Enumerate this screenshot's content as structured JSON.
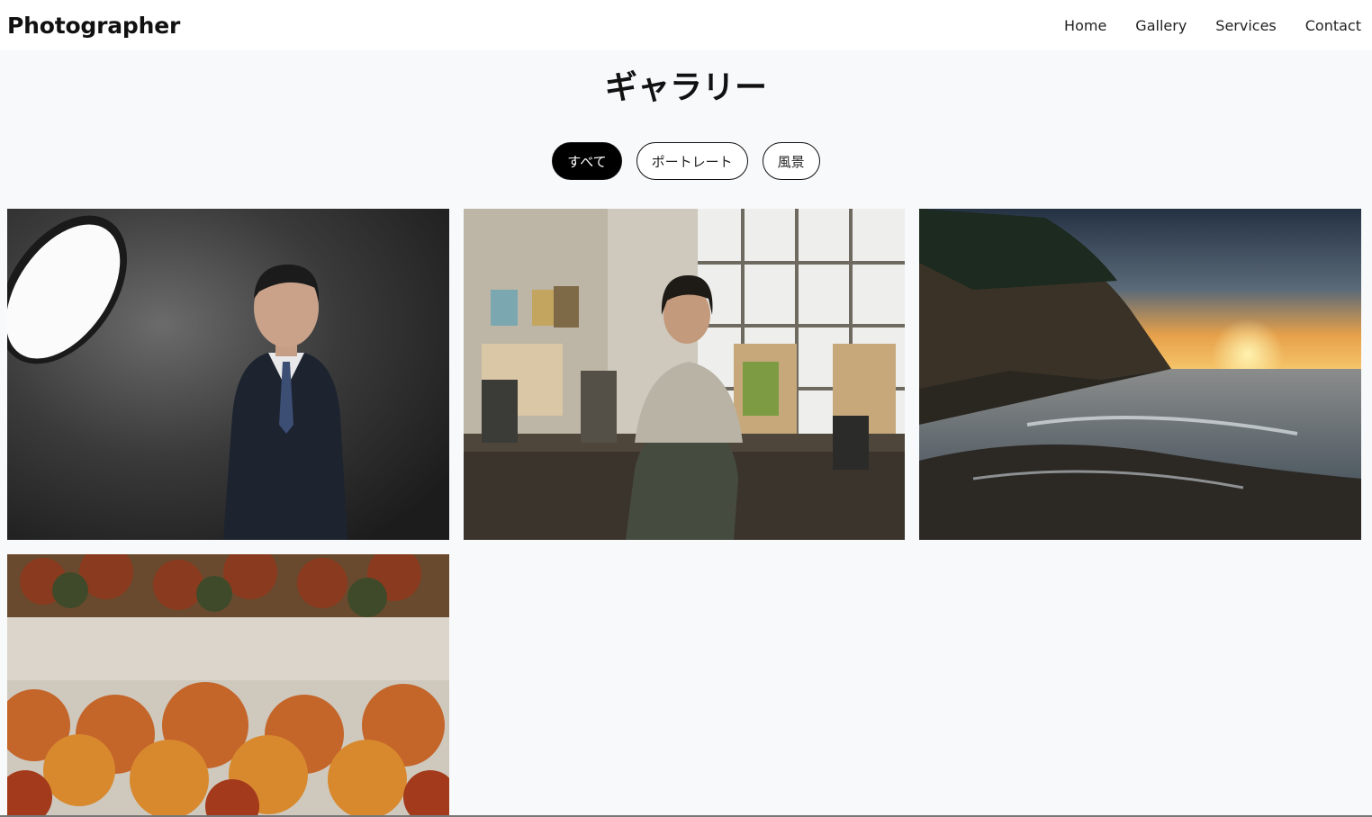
{
  "brand": "Photographer",
  "nav": [
    "Home",
    "Gallery",
    "Services",
    "Contact"
  ],
  "page_title": "ギャラリー",
  "filters": [
    {
      "label": "すべて",
      "active": true
    },
    {
      "label": "ポートレート",
      "active": false
    },
    {
      "label": "風景",
      "active": false
    }
  ],
  "photos": [
    {
      "name": "portrait-businessman-photo"
    },
    {
      "name": "portrait-artist-studio-photo"
    },
    {
      "name": "landscape-coast-sunset-photo"
    },
    {
      "name": "landscape-autumn-forest-fog-photo"
    }
  ]
}
